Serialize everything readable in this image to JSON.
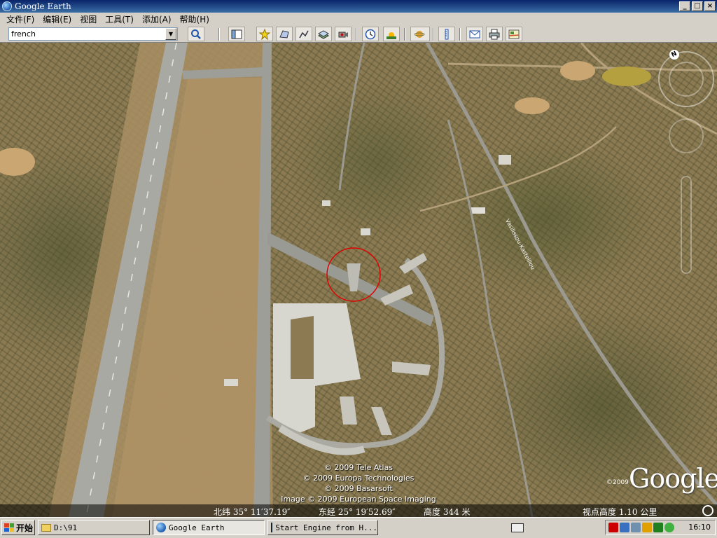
{
  "window": {
    "title": "Google Earth",
    "buttons": [
      "_",
      "□",
      "×"
    ]
  },
  "menu": [
    "文件(F)",
    "编辑(E)",
    "视图",
    "工具(T)",
    "添加(A)",
    "帮助(H)"
  ],
  "search": {
    "value": "french"
  },
  "toolbar": {
    "icons": [
      "search-icon",
      "sidebar-icon",
      "placemark-icon",
      "polygon-icon",
      "path-icon",
      "overlay-icon",
      "record-tour-icon",
      "historical-imagery-icon",
      "sunlight-icon",
      "planet-icon",
      "ruler-icon",
      "email-icon",
      "print-icon",
      "view-in-maps-icon"
    ]
  },
  "map": {
    "road_label": "Vasilissou-Kastelliou",
    "credits": [
      "© 2009 Tele Atlas",
      "© 2009 Europa Technologies",
      "© 2009 Basarsoft",
      "Image © 2009 European Space Imaging"
    ],
    "logo": "Google",
    "logo_year": "©2009",
    "north_label": "N"
  },
  "status": {
    "lat": "北纬  35° 11′37.19″",
    "lon": "东经  25° 19′52.69″",
    "elev": "高度   344 米",
    "eye_alt": "视点高度       1.10 公里"
  },
  "taskbar": {
    "start": "开始",
    "tasks": [
      {
        "label": "D:\\91"
      },
      {
        "label": "Google Earth"
      },
      {
        "label": "Start Engine from H..."
      }
    ],
    "time": "16:10"
  },
  "colors": {
    "titlebar": "#0a246a",
    "chrome": "#d4d0c8",
    "highlight_circle": "#e00000"
  }
}
